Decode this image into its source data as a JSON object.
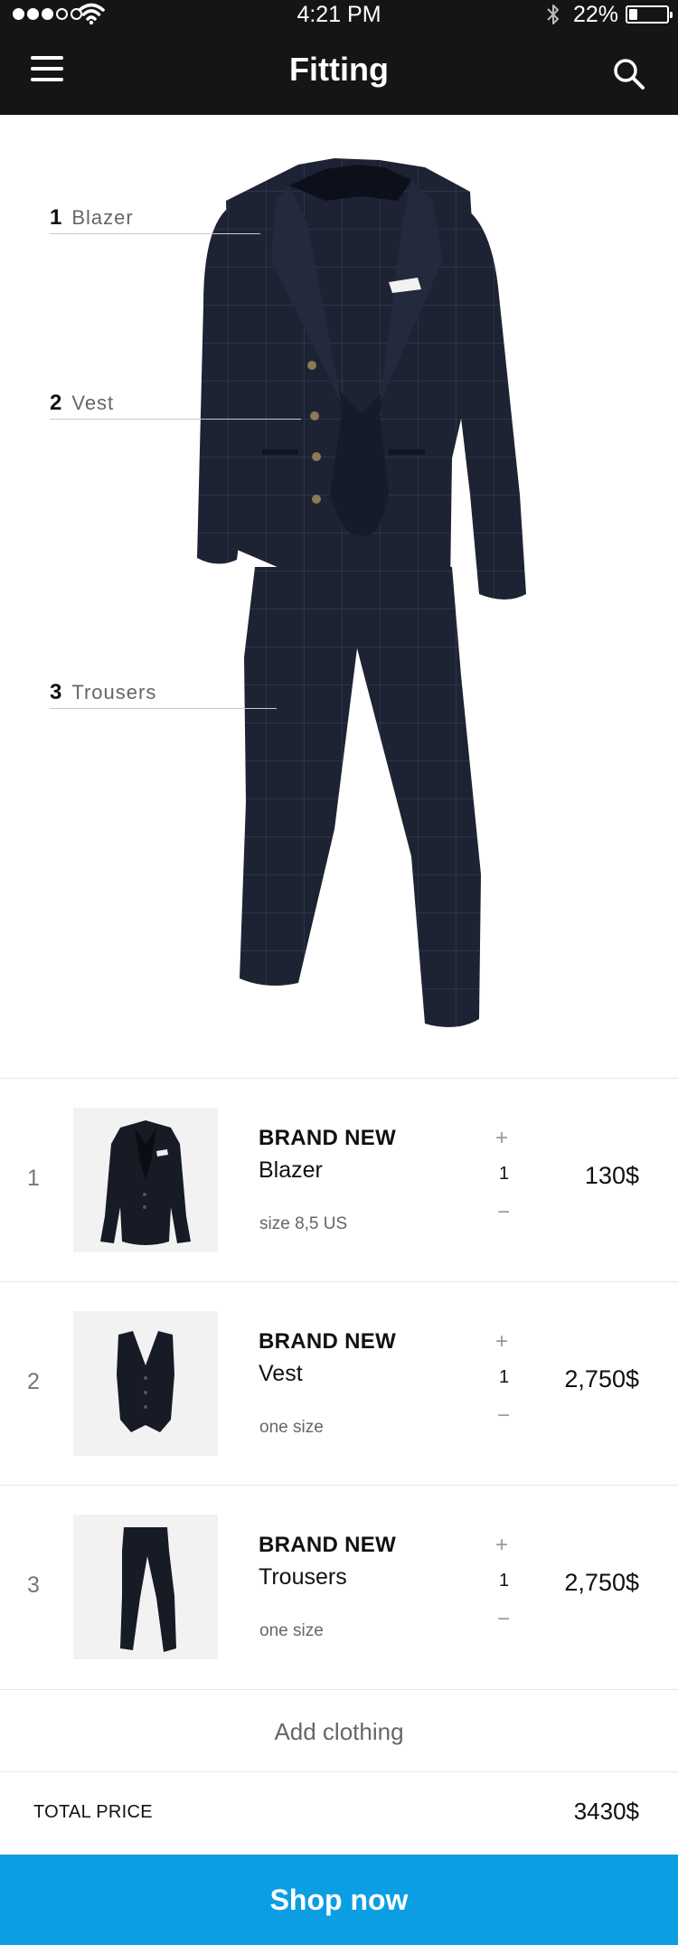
{
  "status_bar": {
    "time": "4:21 PM",
    "battery_text": "22%",
    "battery_level": 0.22,
    "signal_bars_filled": 3,
    "signal_bars_total": 5
  },
  "header": {
    "title": "Fitting",
    "menu_icon": "hamburger-menu-icon",
    "search_icon": "search-icon"
  },
  "outfit": {
    "callouts": [
      {
        "number": "1",
        "label": "Blazer"
      },
      {
        "number": "2",
        "label": "Vest"
      },
      {
        "number": "3",
        "label": "Trousers"
      }
    ]
  },
  "cart": {
    "items": [
      {
        "index": "1",
        "brand": "BRAND NEW",
        "name": "Blazer",
        "size": "size 8,5 US",
        "plus": "+",
        "qty": "1",
        "minus": "−",
        "price": "130$"
      },
      {
        "index": "2",
        "brand": "BRAND NEW",
        "name": "Vest",
        "size": "one size",
        "plus": "+",
        "qty": "1",
        "minus": "−",
        "price": "2,750$"
      },
      {
        "index": "3",
        "brand": "BRAND NEW",
        "name": "Trousers",
        "size": "one size",
        "plus": "+",
        "qty": "1",
        "minus": "−",
        "price": "2,750$"
      }
    ],
    "add_label": "Add clothing",
    "total_label": "TOTAL PRICE",
    "total_value": "3430$"
  },
  "cta": {
    "label": "Shop now"
  },
  "colors": {
    "header_bg": "#151515",
    "accent": "#0b9ee3",
    "suit": "#1d2333"
  }
}
